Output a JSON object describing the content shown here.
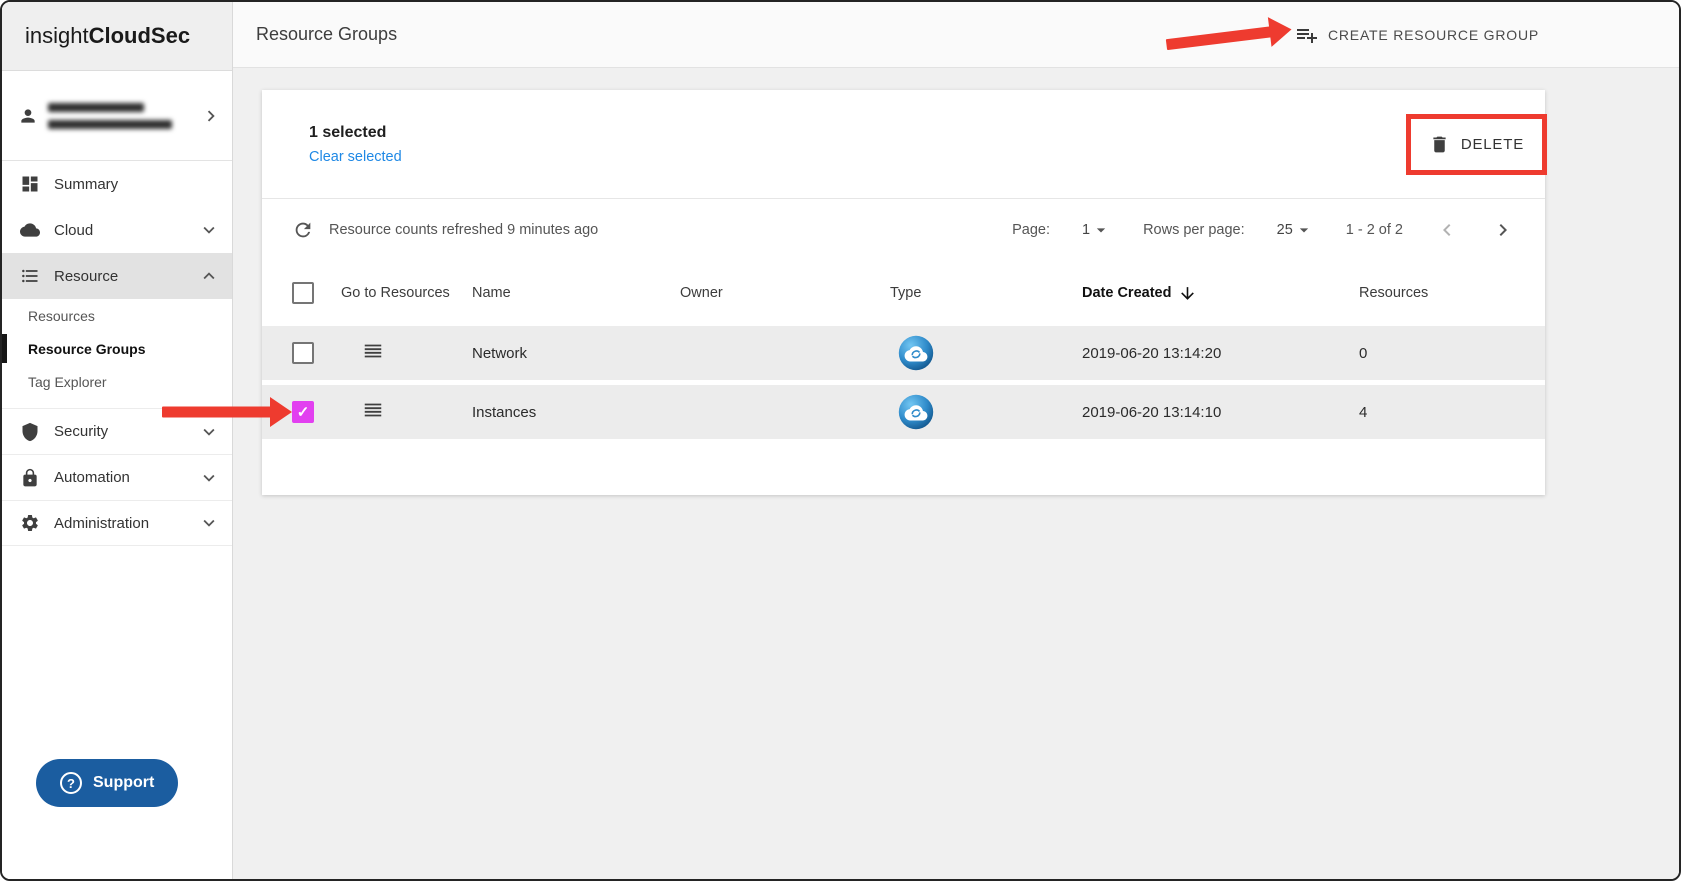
{
  "colors": {
    "annotation_red": "#ee3b2f",
    "link_blue": "#1e88e5",
    "support_button_blue": "#1b5da0",
    "checkbox_checked_magenta": "#e240f0",
    "type_icon_blue": "#2f8bca"
  },
  "sidebar": {
    "logo_prefix": "insight",
    "logo_suffix": "CloudSec",
    "items": [
      {
        "label": "Summary"
      },
      {
        "label": "Cloud"
      },
      {
        "label": "Resource"
      },
      {
        "label": "Security"
      },
      {
        "label": "Automation"
      },
      {
        "label": "Administration"
      }
    ],
    "resource_subitems": [
      {
        "label": "Resources"
      },
      {
        "label": "Resource Groups"
      },
      {
        "label": "Tag Explorer"
      }
    ],
    "support_label": "Support"
  },
  "header": {
    "title": "Resource Groups",
    "create_button_label": "CREATE RESOURCE GROUP"
  },
  "selection": {
    "count_text": "1 selected",
    "clear_label": "Clear selected",
    "delete_label": "DELETE"
  },
  "toolbar": {
    "refresh_text": "Resource counts refreshed 9 minutes ago",
    "page_label": "Page:",
    "page_value": "1",
    "rows_label": "Rows per page:",
    "rows_value": "25",
    "range_text": "1 - 2 of 2"
  },
  "table": {
    "headers": {
      "goto": "Go to Resources",
      "name": "Name",
      "owner": "Owner",
      "type": "Type",
      "date_created": "Date Created",
      "resources": "Resources"
    },
    "rows": [
      {
        "name": "Network",
        "owner": "",
        "date_created": "2019-06-20 13:14:20",
        "resources": "0",
        "checked": false
      },
      {
        "name": "Instances",
        "owner": "",
        "date_created": "2019-06-20 13:14:10",
        "resources": "4",
        "checked": true
      }
    ]
  }
}
